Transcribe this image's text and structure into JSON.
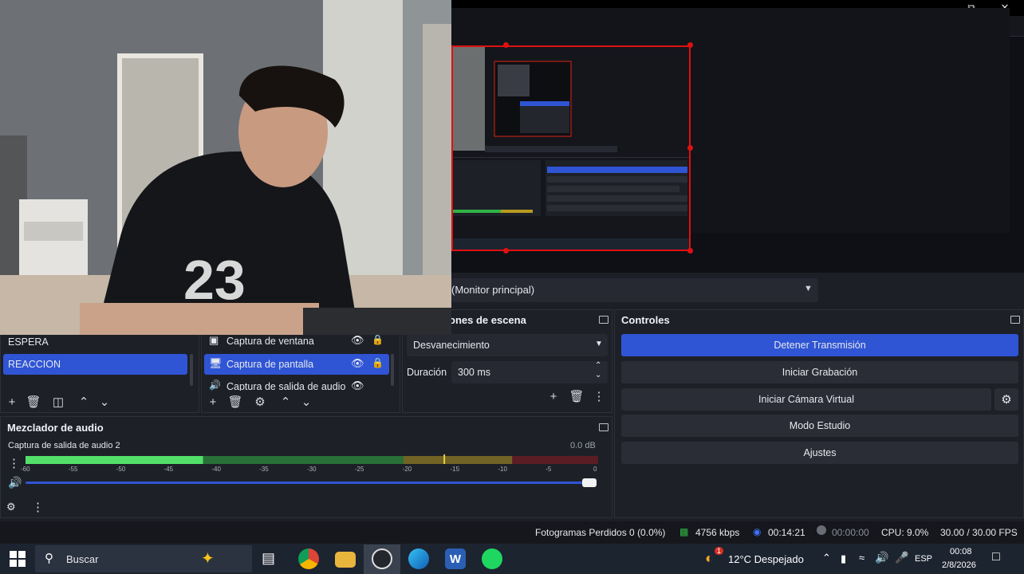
{
  "window": {
    "minimize_icon": "minimize-icon",
    "restore_icon": "restore-icon",
    "close_icon": "close-icon"
  },
  "preview": {
    "source_selector_value": "(Monitor principal)"
  },
  "scenes": {
    "items": [
      {
        "label": "ESPERA"
      },
      {
        "label": "REACCION"
      }
    ]
  },
  "sources": {
    "items": [
      {
        "label": "Captura de ventana"
      },
      {
        "label": "Captura de pantalla"
      },
      {
        "label": "Captura de salida de audio"
      }
    ]
  },
  "transitions": {
    "title": "ones de escena",
    "transition_value": "Desvanecimiento",
    "duration_label": "Duración",
    "duration_value": "300 ms"
  },
  "controls": {
    "title": "Controles",
    "stop_stream": "Detener Transmisión",
    "start_recording": "Iniciar Grabación",
    "start_virtual_cam": "Iniciar Cámara Virtual",
    "studio_mode": "Modo Estudio",
    "settings": "Ajustes"
  },
  "mixer": {
    "title": "Mezclador de audio",
    "channel_name": "Captura de salida de audio 2",
    "db_value": "0.0 dB",
    "scale": [
      "-60",
      "-55",
      "-50",
      "-45",
      "-40",
      "-35",
      "-30",
      "-25",
      "-20",
      "-15",
      "-10",
      "-5",
      "0"
    ],
    "level_fraction": 0.31,
    "volume_fraction": 1.0
  },
  "status": {
    "dropped_frames": "Fotogramas Perdidos 0 (0.0%)",
    "bitrate": "4756 kbps",
    "stream_time": "00:14:21",
    "rec_time": "00:00:00",
    "cpu": "CPU: 9.0%",
    "fps": "30.00 / 30.00 FPS"
  },
  "taskbar": {
    "search_placeholder": "Buscar",
    "weather_badge": "1",
    "weather": "12°C  Despejado",
    "language": "ESP",
    "time": "00:08",
    "date": "2/8/2026"
  },
  "colors": {
    "accent": "#2f55d4",
    "selection_red": "#e01010",
    "meter_green": "#2fb344",
    "meter_yellow": "#b79b20",
    "meter_red": "#8e1c20"
  }
}
